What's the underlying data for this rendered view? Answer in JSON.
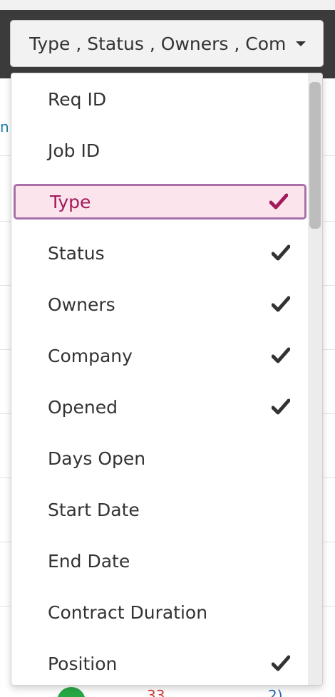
{
  "select": {
    "value_text": "Type , Status , Owners , Com"
  },
  "menu": {
    "items": [
      {
        "label": "Req ID",
        "checked": false,
        "highlighted": false
      },
      {
        "label": "Job ID",
        "checked": false,
        "highlighted": false
      },
      {
        "label": "Type",
        "checked": true,
        "highlighted": true
      },
      {
        "label": "Status",
        "checked": true,
        "highlighted": false
      },
      {
        "label": "Owners",
        "checked": true,
        "highlighted": false
      },
      {
        "label": "Company",
        "checked": true,
        "highlighted": false
      },
      {
        "label": "Opened",
        "checked": true,
        "highlighted": false
      },
      {
        "label": "Days Open",
        "checked": false,
        "highlighted": false
      },
      {
        "label": "Start Date",
        "checked": false,
        "highlighted": false
      },
      {
        "label": "End Date",
        "checked": false,
        "highlighted": false
      },
      {
        "label": "Contract Duration",
        "checked": false,
        "highlighted": false
      },
      {
        "label": "Position",
        "checked": true,
        "highlighted": false
      }
    ]
  },
  "colors": {
    "highlight_bg": "#fbe4ec",
    "highlight_border": "#a970a8",
    "highlight_text": "#a3195b",
    "check_default": "#333333"
  },
  "icons": {
    "check": "check-icon",
    "caret": "caret-down-icon"
  },
  "background": {
    "peek_text": "n",
    "peek_red": "33",
    "peek_blue": "2)"
  }
}
